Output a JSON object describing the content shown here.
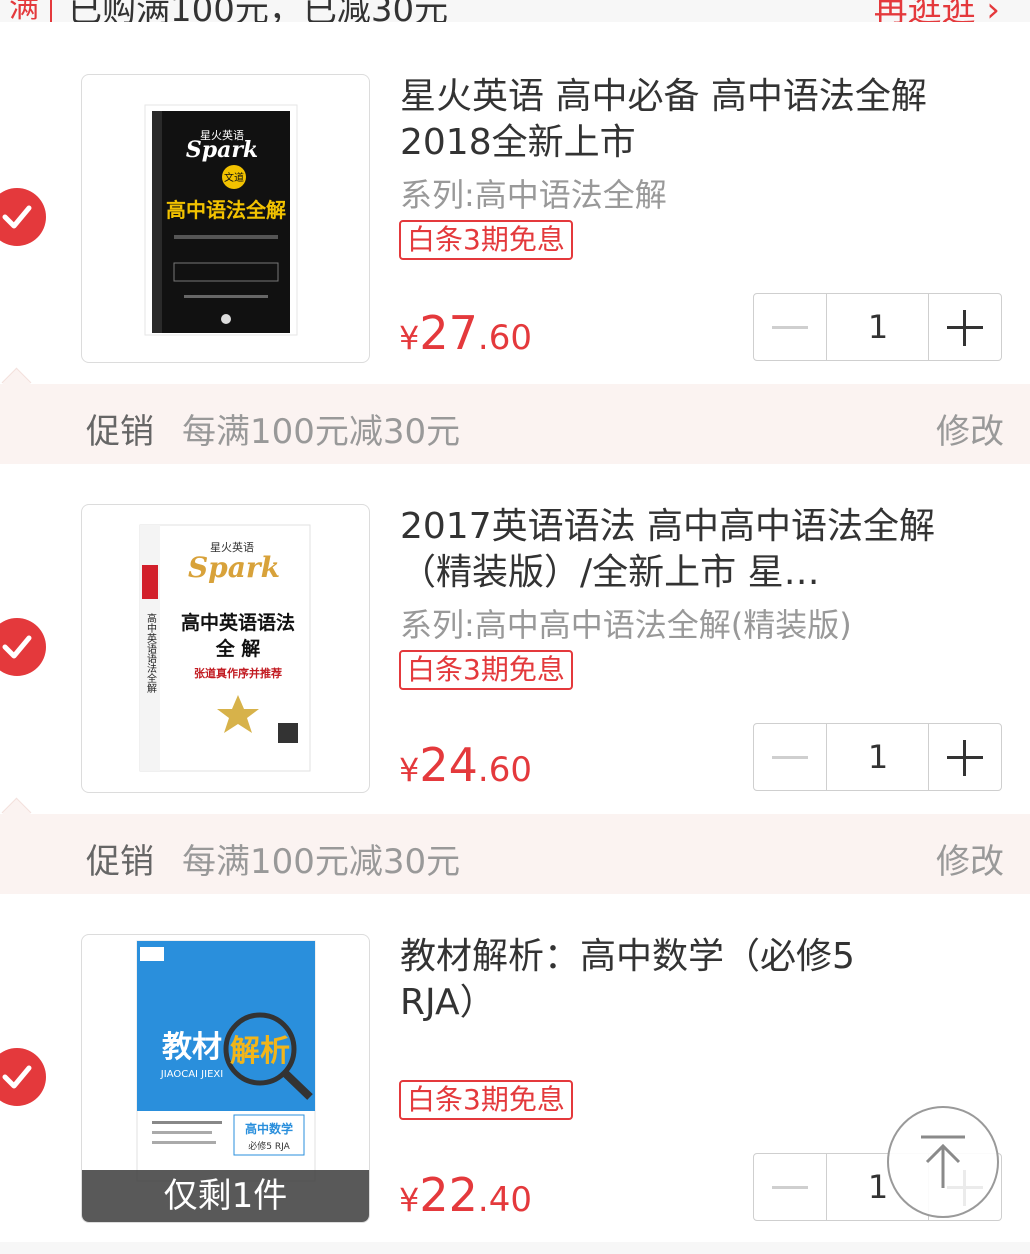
{
  "top": {
    "badge": "满",
    "text": "已购满100元，已减30元",
    "link": "再逛逛 ›"
  },
  "items": [
    {
      "title": "星火英语 高中必备 高中语法全解 2018全新上市",
      "series": "系列:高中语法全解",
      "tag": "白条3期免息",
      "price_currency": "¥",
      "price_int": "27",
      "price_dec": ".60",
      "qty": "1",
      "cover": {
        "brand_cn": "星火英语",
        "brand": "Spark",
        "badge": "文道",
        "title": "高中语法全解"
      }
    },
    {
      "title": "2017英语语法 高中高中语法全解（精装版）/全新上市 星…",
      "series": "系列:高中高中语法全解(精装版)",
      "tag": "白条3期免息",
      "price_currency": "¥",
      "price_int": "24",
      "price_dec": ".60",
      "qty": "1",
      "cover": {
        "brand_cn": "星火英语",
        "brand": "Spark",
        "title1": "高中英语语法",
        "title2": "全 解",
        "spine": "高中英语语法全解",
        "sub": "张道真作序并推荐"
      }
    },
    {
      "title": "教材解析：高中数学（必修5 RJA）",
      "series": "",
      "tag": "白条3期免息",
      "price_currency": "¥",
      "price_int": "22",
      "price_dec": ".40",
      "qty": "1",
      "stock": "仅剩1件",
      "cover": {
        "t1": "教材",
        "t2": "解析",
        "pinyin": "JIAOCAI JIEXI",
        "subject": "高中数学",
        "edition": "必修5 RJA"
      }
    }
  ],
  "promos": [
    {
      "label": "促销",
      "desc": "每满100元减30元",
      "edit": "修改"
    },
    {
      "label": "促销",
      "desc": "每满100元减30元",
      "edit": "修改"
    }
  ],
  "colors": {
    "accent": "#e4393c",
    "promo_bg": "#fbf3f1",
    "muted": "#999999"
  },
  "icons": {
    "check": "check-icon",
    "minus": "minus-icon",
    "plus": "plus-icon",
    "totop": "arrow-up-icon"
  }
}
